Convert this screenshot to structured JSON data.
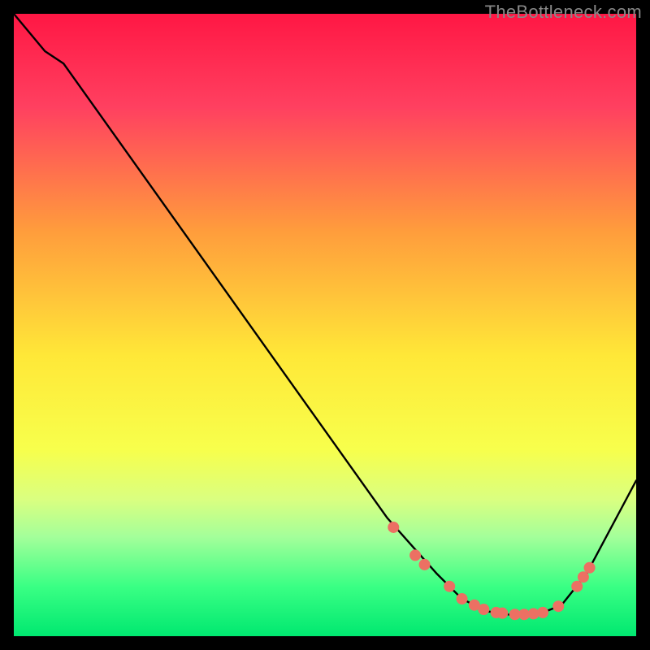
{
  "watermark": "TheBottleneck.com",
  "chart_data": {
    "type": "line",
    "title": "",
    "xlabel": "",
    "ylabel": "",
    "xlim": [
      0,
      100
    ],
    "ylim": [
      0,
      100
    ],
    "background_gradient": {
      "stops": [
        {
          "offset": 0,
          "color": "#ff1744"
        },
        {
          "offset": 15,
          "color": "#ff4060"
        },
        {
          "offset": 35,
          "color": "#ff9d3c"
        },
        {
          "offset": 55,
          "color": "#ffe838"
        },
        {
          "offset": 70,
          "color": "#f7ff4c"
        },
        {
          "offset": 78,
          "color": "#daff80"
        },
        {
          "offset": 84,
          "color": "#a4ff9a"
        },
        {
          "offset": 92,
          "color": "#3aff84"
        },
        {
          "offset": 100,
          "color": "#00e870"
        }
      ]
    },
    "series": [
      {
        "name": "bottleneck-curve",
        "type": "line",
        "x": [
          0,
          5,
          8,
          60,
          68,
          72,
          76,
          80,
          84,
          88,
          92,
          100
        ],
        "y": [
          100,
          94,
          92,
          19,
          10,
          6,
          4,
          3.4,
          3.4,
          5,
          10,
          25
        ]
      },
      {
        "name": "marker-points",
        "type": "scatter",
        "x": [
          61,
          64.5,
          66,
          70,
          72,
          74,
          75.5,
          77.5,
          78.5,
          80.5,
          82,
          83.5,
          85,
          87.5,
          90.5,
          91.5,
          92.5
        ],
        "y": [
          17.5,
          13,
          11.5,
          8,
          6,
          5,
          4.3,
          3.8,
          3.7,
          3.5,
          3.5,
          3.6,
          3.8,
          4.8,
          8,
          9.5,
          11
        ]
      }
    ],
    "marker_style": {
      "fill": "#ec7063",
      "radius": 7
    },
    "line_style": {
      "stroke": "#000000",
      "width": 2.4
    }
  }
}
